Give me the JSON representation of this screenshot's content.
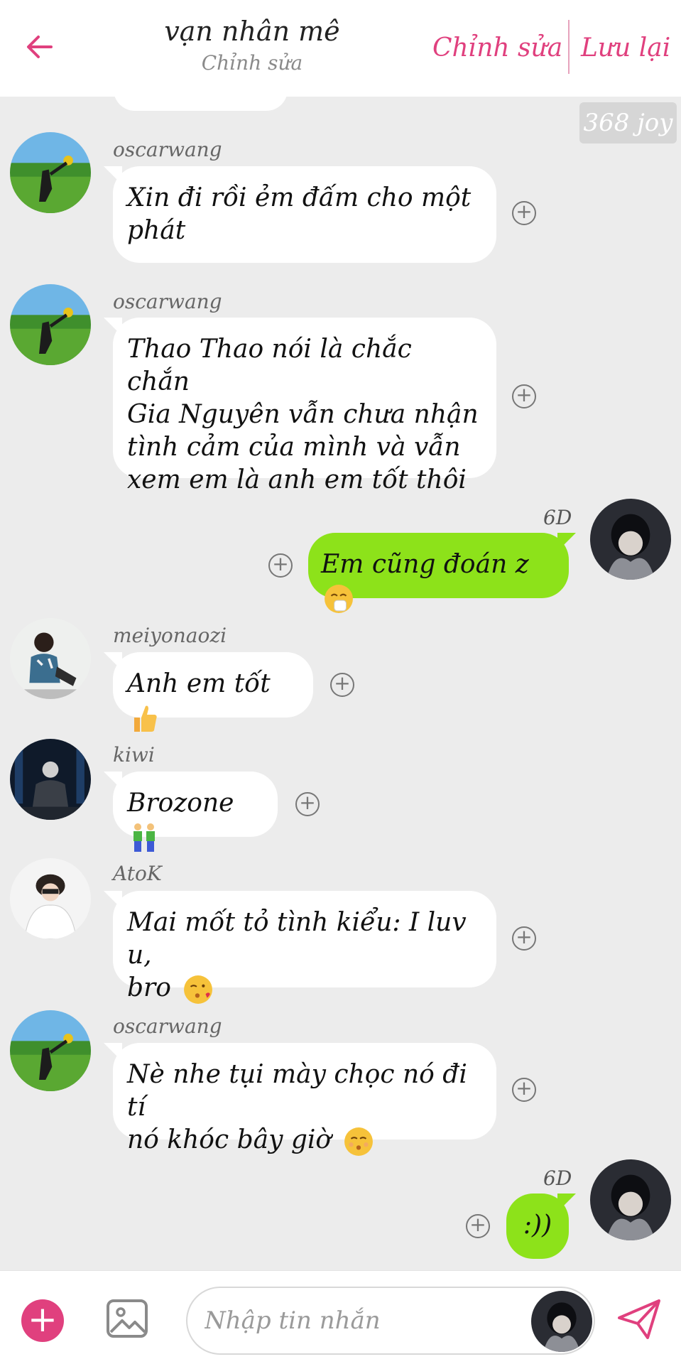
{
  "header": {
    "title": "vạn nhân mê",
    "subtitle": "Chỉnh sửa",
    "edit_label": "Chỉnh sửa",
    "save_label": "Lưu lại"
  },
  "joy_badge": "368 joy",
  "colors": {
    "accent": "#e0407e",
    "mine_bubble": "#8de21a",
    "background": "#ececec"
  },
  "messages": [
    {
      "sender": "oscarwang",
      "text": "Xin đi rồi ẻm đấm cho một\nphát",
      "avatar": "field-photo-avatar"
    },
    {
      "sender": "oscarwang",
      "text": "Thao Thao nói là chắc chắn\nGia Nguyên vẫn chưa nhận\ntình cảm của mình và vẫn\nxem em là anh em tốt thôi",
      "avatar": "field-photo-avatar"
    },
    {
      "sender": "6D",
      "text": "Em cũng đoán z",
      "emoji": "sneezing-face",
      "mine": true,
      "avatar": "hoodie-boy-avatar"
    },
    {
      "sender": "meiyonaozi",
      "text": "Anh em tốt",
      "emoji": "thumbs-up",
      "avatar": "sitting-boy-avatar"
    },
    {
      "sender": "kiwi",
      "text": "Brozone",
      "emoji": "two-men-holding-hands",
      "avatar": "dark-stage-avatar"
    },
    {
      "sender": "AtoK",
      "text": "Mai mốt tỏ tình kiểu: I luv u,\nbro",
      "emoji": "face-blowing-kiss",
      "avatar": "white-hoodie-avatar"
    },
    {
      "sender": "oscarwang",
      "text": "Nè nhe tụi mày chọc nó đi tí\nnó khóc bây giờ",
      "emoji": "kissing-smiling-eyes",
      "avatar": "field-photo-avatar"
    },
    {
      "sender": "6D",
      "text": ":))",
      "mine": true,
      "avatar": "hoodie-boy-avatar"
    }
  ],
  "composer": {
    "placeholder": "Nhập tin nhắn"
  }
}
